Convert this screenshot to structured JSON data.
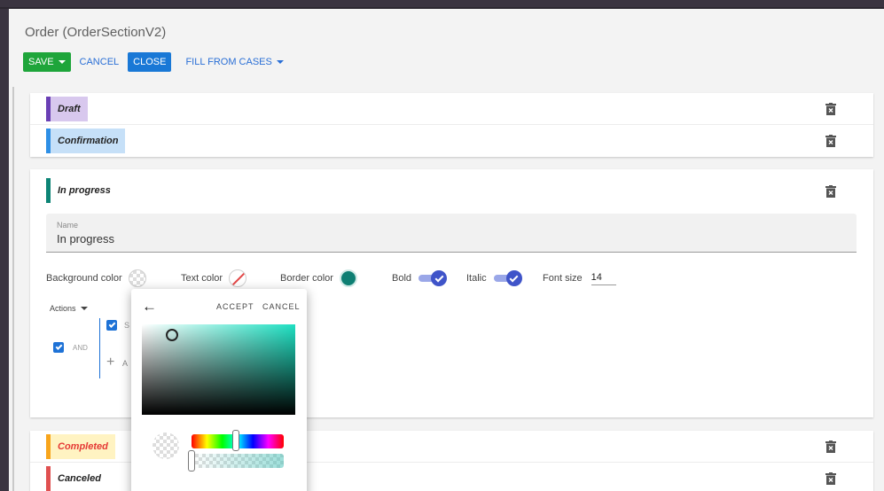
{
  "window": {
    "title": "Order (OrderSectionV2)"
  },
  "toolbar": {
    "save_label": "SAVE",
    "cancel_label": "CANCEL",
    "close_label": "CLOSE",
    "fill_label": "FILL FROM CASES"
  },
  "stages": {
    "draft": {
      "label": "Draft",
      "accent": "#6a3fb5",
      "label_bg": "#d8c8ee"
    },
    "confirmation": {
      "label": "Confirmation",
      "accent": "#2e8fe6",
      "label_bg": "#c6e0f8"
    },
    "in_progress": {
      "label": "In progress",
      "accent": "#0c8475",
      "label_bg": "#ffffff"
    },
    "completed": {
      "label": "Completed",
      "accent": "#f8a51c",
      "label_bg": "#fff3c2",
      "text_color": "#e53935"
    },
    "canceled": {
      "label": "Canceled",
      "accent": "#e05050",
      "label_bg": "#ffffff"
    }
  },
  "editor": {
    "name_label": "Name",
    "name_value": "In progress",
    "background_color_label": "Background color",
    "text_color_label": "Text color",
    "border_color_label": "Border color",
    "bold_label": "Bold",
    "italic_label": "Italic",
    "font_size_label": "Font size",
    "font_size_value": "14",
    "bold_on": true,
    "italic_on": true
  },
  "conditions": {
    "actions_label": "Actions",
    "and_label": "AND",
    "rule_text": "S",
    "add_text": "A"
  },
  "color_picker": {
    "accept_label": "ACCEPT",
    "cancel_label": "CANCEL",
    "base_hue": "#1ee0c2"
  },
  "icons": {
    "trash": "trash-icon",
    "back": "arrow-back-icon",
    "add": "plus-icon"
  }
}
